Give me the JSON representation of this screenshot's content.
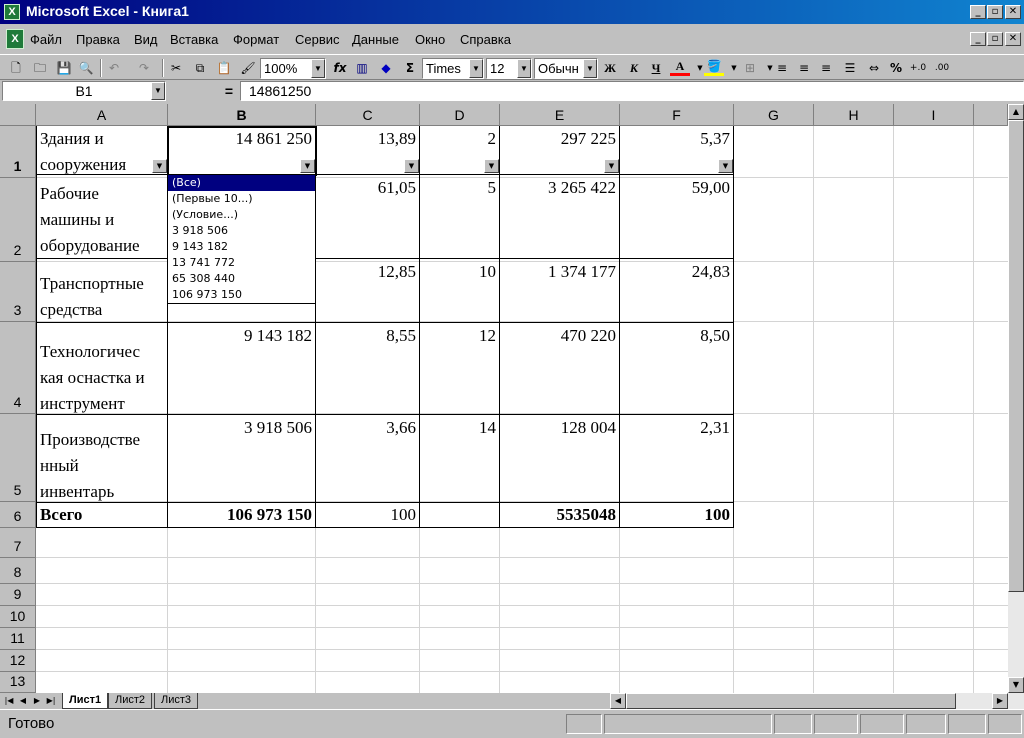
{
  "window": {
    "title": "Microsoft Excel - Книга1",
    "app_icon": "excel-icon",
    "controls": [
      "_",
      "▫",
      "✕"
    ]
  },
  "menu": {
    "items": [
      "Файл",
      "Правка",
      "Вид",
      "Вставка",
      "Формат",
      "Сервис",
      "Данные",
      "Окно",
      "Справка"
    ],
    "doc_controls": [
      "_",
      "▫",
      "✕"
    ]
  },
  "toolbar": {
    "zoom": "100%",
    "font_name": "Times",
    "font_size": "12",
    "style": "Обычн",
    "bold_label": "Ж",
    "italic_label": "К",
    "underline_label": "Ч",
    "font_color_label": "A",
    "percent_label": "%",
    "fx_label": "fx",
    "sigma_label": "Σ",
    "font_color": "#ff0000",
    "fill_color": "#ffff00"
  },
  "formula_bar": {
    "name_box": "B1",
    "equals": "=",
    "content": "14861250"
  },
  "columns": [
    "A",
    "B",
    "C",
    "D",
    "E",
    "F",
    "G",
    "H",
    "I"
  ],
  "rows": [
    "1",
    "2",
    "3",
    "4",
    "5",
    "6",
    "7",
    "8",
    "9",
    "10",
    "11",
    "12",
    "13"
  ],
  "table": [
    {
      "a": "Здания и\nсооружения",
      "b": "14 861 250",
      "c": "13,89",
      "d": "2",
      "e": "297 225",
      "f": "5,37"
    },
    {
      "a": "Рабочие\nмашины и\nоборудование",
      "b": "",
      "c": "61,05",
      "d": "5",
      "e": "3 265 422",
      "f": "59,00"
    },
    {
      "a": "Транспортные\nсредства",
      "b": "",
      "c": "12,85",
      "d": "10",
      "e": "1 374 177",
      "f": "24,83"
    },
    {
      "a": "Технологичес\nкая оснастка и\nинструмент",
      "b": "9 143 182",
      "c": "8,55",
      "d": "12",
      "e": "470 220",
      "f": "8,50"
    },
    {
      "a": "Производстве\nнный\nинвентарь",
      "b": "3 918 506",
      "c": "3,66",
      "d": "14",
      "e": "128 004",
      "f": "2,31"
    },
    {
      "a": "Всего",
      "b": "106 973 150",
      "c": "100",
      "d": "",
      "e": "5535048",
      "f": "100"
    }
  ],
  "filter_dropdown": {
    "items": [
      "(Все)",
      "(Первые 10...)",
      "(Условие...)",
      "3 918 506",
      "9 143 182",
      "13 741 772",
      "65 308 440",
      "106 973 150"
    ],
    "selected_index": 0
  },
  "sheets": {
    "tabs": [
      "Лист1",
      "Лист2",
      "Лист3"
    ],
    "active": "Лист1"
  },
  "status": {
    "text": "Готово"
  }
}
